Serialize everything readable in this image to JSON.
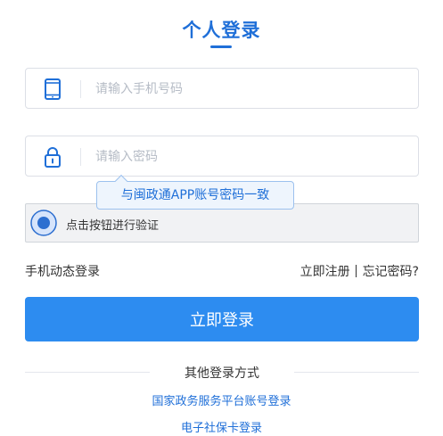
{
  "header": {
    "title": "个人登录"
  },
  "phone_field": {
    "icon": "mobile-phone-icon",
    "placeholder": "请输入手机号码",
    "value": ""
  },
  "password_field": {
    "icon": "lock-icon",
    "placeholder": "请输入密码",
    "value": ""
  },
  "tooltip": {
    "text": "与闽政通APP账号密码一致"
  },
  "verify": {
    "icon": "radio-knob-icon",
    "text": "点击按钮进行验证"
  },
  "links": {
    "sms_login": "手机动态登录",
    "register": "立即注册",
    "forgot": "忘记密码?"
  },
  "login_button": {
    "label": "立即登录"
  },
  "other": {
    "divider_text": "其他登录方式",
    "options": [
      "国家政务服务平台账号登录",
      "电子社保卡登录"
    ]
  },
  "colors": {
    "accent": "#1f6fd8",
    "button": "#2d8cf0",
    "tooltip_bg": "#eef5fd",
    "tooltip_border": "#9cc1ee"
  }
}
